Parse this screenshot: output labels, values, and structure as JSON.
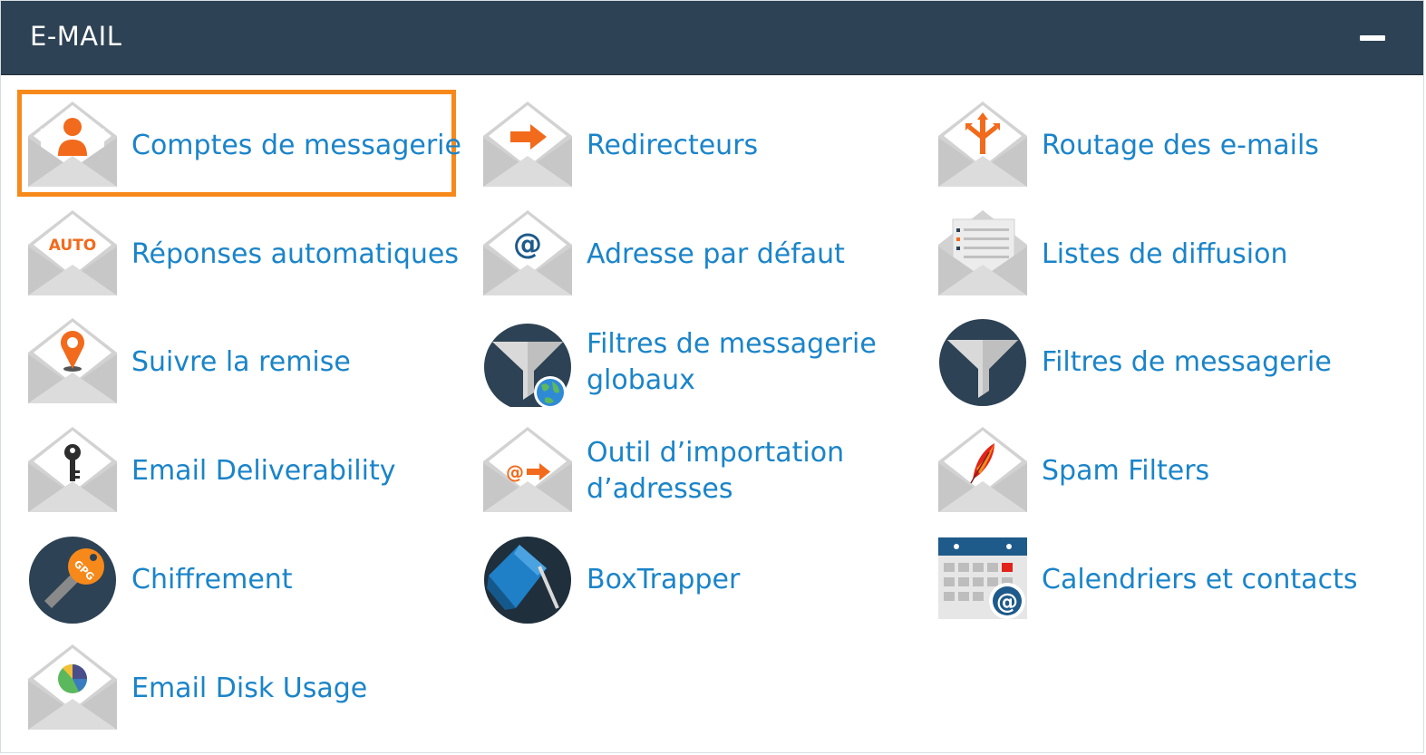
{
  "header": {
    "title": "E-MAIL",
    "collapse_icon": "minus-icon"
  },
  "colors": {
    "header_bg": "#2d4254",
    "link": "#1a84c9",
    "accent": "#f7891a",
    "icon_orange": "#f26a1b",
    "icon_dark": "#2d4254"
  },
  "selected_item": "Comptes de messagerie",
  "items": [
    {
      "label": "Comptes de messagerie",
      "icon": "email-accounts-icon"
    },
    {
      "label": "Redirecteurs",
      "icon": "forwarders-icon"
    },
    {
      "label": "Routage des e-mails",
      "icon": "email-routing-icon"
    },
    {
      "label": "Réponses automatiques",
      "icon": "autoresponders-icon",
      "icon_text": "AUTO"
    },
    {
      "label": "Adresse par défaut",
      "icon": "default-address-icon",
      "icon_text": "@"
    },
    {
      "label": "Listes de diffusion",
      "icon": "mailing-lists-icon"
    },
    {
      "label": "Suivre la remise",
      "icon": "track-delivery-icon"
    },
    {
      "label": "Filtres de messagerie globaux",
      "icon": "global-filters-icon"
    },
    {
      "label": "Filtres de messagerie",
      "icon": "email-filters-icon"
    },
    {
      "label": "Email Deliverability",
      "icon": "deliverability-key-icon"
    },
    {
      "label": "Outil d’importation d’adresses",
      "icon": "address-importer-icon",
      "icon_text": "@"
    },
    {
      "label": "Spam Filters",
      "icon": "spam-filters-icon"
    },
    {
      "label": "Chiffrement",
      "icon": "encryption-key-icon",
      "icon_text": "GPG"
    },
    {
      "label": "BoxTrapper",
      "icon": "boxtrapper-icon"
    },
    {
      "label": "Calendriers et contacts",
      "icon": "calendar-contacts-icon",
      "icon_text": "@"
    },
    {
      "label": "Email Disk Usage",
      "icon": "disk-usage-icon"
    }
  ]
}
